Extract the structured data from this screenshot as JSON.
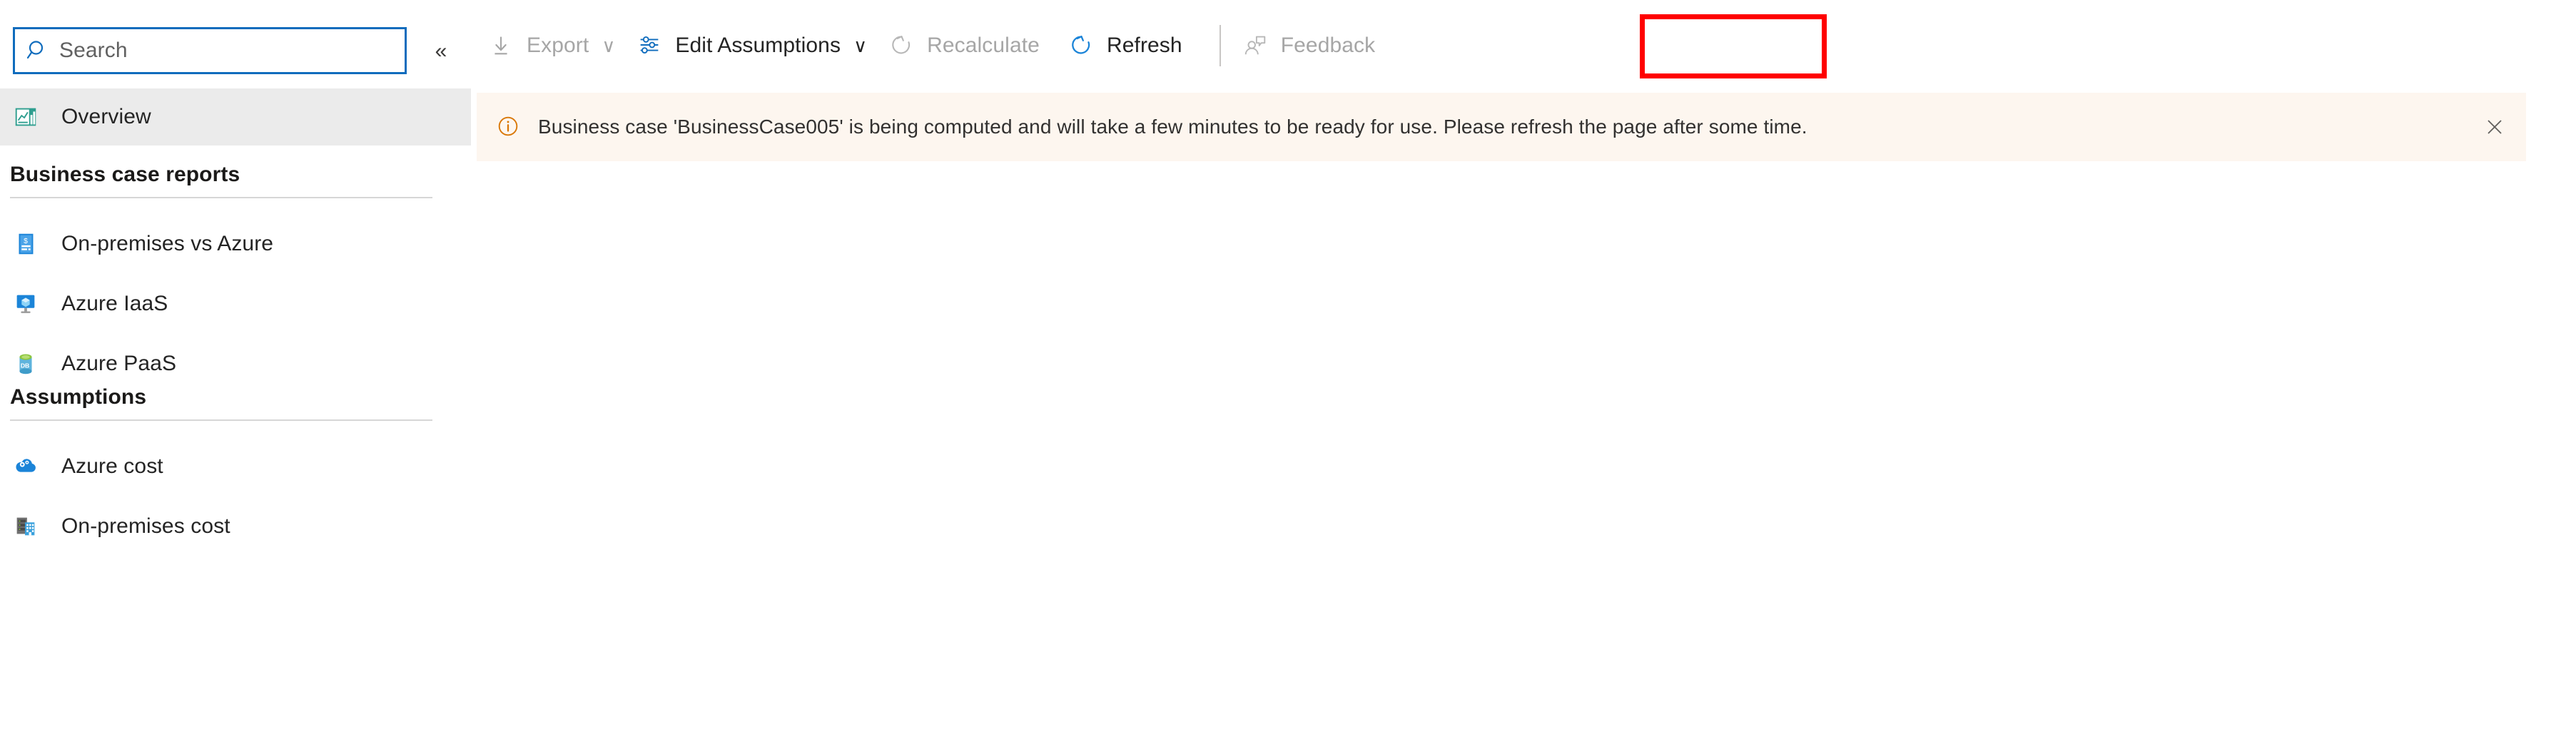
{
  "sidebar": {
    "search": {
      "placeholder": "Search",
      "value": "",
      "icon": "search-icon"
    },
    "collapse_label": "«",
    "overview": {
      "label": "Overview",
      "icon": "chart-report-icon",
      "selected": true
    },
    "sections": [
      {
        "title": "Business case reports",
        "items": [
          {
            "label": "On-premises vs Azure",
            "icon": "invoice-document-icon"
          },
          {
            "label": "Azure IaaS",
            "icon": "virtual-machine-icon"
          },
          {
            "label": "Azure PaaS",
            "icon": "database-icon"
          }
        ]
      },
      {
        "title": "Assumptions",
        "items": [
          {
            "label": "Azure cost",
            "icon": "cloud-gear-icon"
          },
          {
            "label": "On-premises cost",
            "icon": "server-building-icon"
          }
        ]
      }
    ]
  },
  "toolbar": {
    "buttons": [
      {
        "label": "Export",
        "icon": "download-arrow-icon",
        "chevron": "∨",
        "disabled": true,
        "highlighted": false
      },
      {
        "label": "Edit Assumptions",
        "icon": "sliders-icon",
        "chevron": "∨",
        "disabled": false,
        "highlighted": false
      },
      {
        "label": "Recalculate",
        "icon": "recalculate-circular-arrow-icon",
        "chevron": "",
        "disabled": true,
        "highlighted": false
      },
      {
        "label": "Refresh",
        "icon": "refresh-circular-arrow-icon",
        "chevron": "",
        "disabled": false,
        "highlighted": true
      },
      {
        "label": "Feedback",
        "icon": "person-speech-bubble-icon",
        "chevron": "",
        "disabled": true,
        "highlighted": false
      }
    ],
    "highlight_color": "#ff0000"
  },
  "banner": {
    "icon": "info-circle-icon",
    "message": "Business case 'BusinessCase005' is being computed and will take a few minutes to be ready for use. Please refresh the page after some time.",
    "close_label": "✕",
    "background_color": "#fdf6ef",
    "icon_color": "#d97706"
  }
}
